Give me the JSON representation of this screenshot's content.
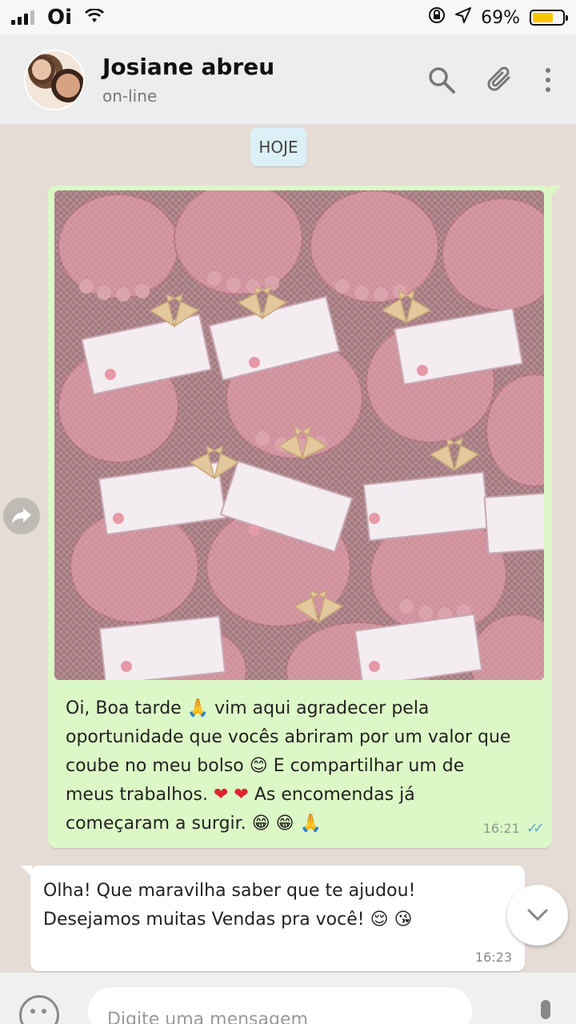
{
  "status_bar": {
    "carrier": "Oi",
    "battery_percent": "69%",
    "battery_level": 0.69
  },
  "header": {
    "contact_name": "Josiane abreu",
    "contact_status": "on-line",
    "icons": [
      "search-icon",
      "attach-icon",
      "menu-icon"
    ]
  },
  "chat": {
    "date_chip": "HOJE",
    "outgoing": {
      "line1_a": "Oi, Boa tarde",
      "line1_b": " vim aqui agradecer pela",
      "line2": "oportunidade que vocês abriram por um valor que",
      "line3_a": "coube no meu bolso",
      "line3_b": " E compartilhar um de",
      "line4_a": "meus trabalhos.",
      "line4_b": " As encomendas já",
      "line5": "começaram a surgir.",
      "emoji_pray": "🙏",
      "emoji_smile": "😊",
      "emoji_heart": "❤",
      "emoji_grin": "😁",
      "time": "16:21"
    },
    "incoming": {
      "line1": "Olha! Que maravilha saber que te ajudou!",
      "line2": "Desejamos muitas Vendas pra você!",
      "emoji_relieved": "😌",
      "emoji_kiss": "😘",
      "time": "16:23"
    }
  },
  "composer": {
    "placeholder": "Digite uma mensagem"
  },
  "colors": {
    "outgoing_bubble": "#dcf8c6",
    "incoming_bubble": "#ffffff",
    "background": "#e5ddd5",
    "read_ticks": "#5fa8e3"
  }
}
